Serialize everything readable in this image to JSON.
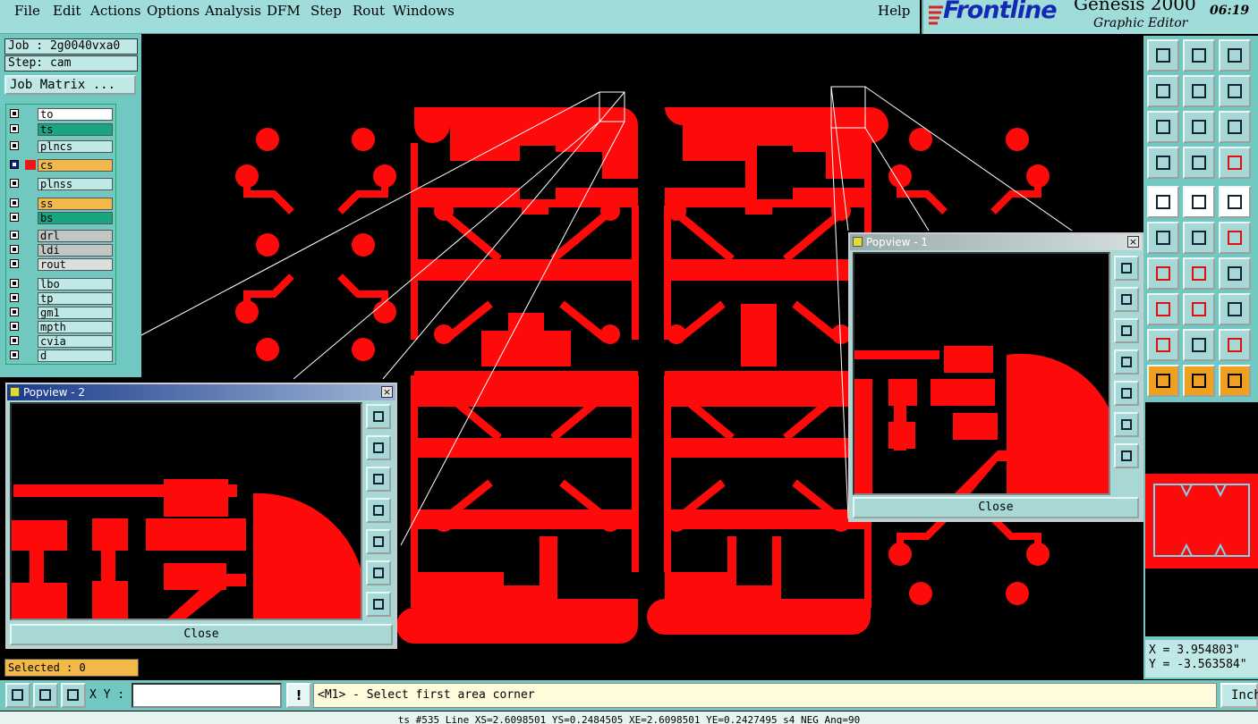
{
  "menu": [
    "File",
    "Edit",
    "Actions",
    "Options",
    "Analysis",
    "DFM",
    "Step",
    "Rout",
    "Windows"
  ],
  "help_label": "Help",
  "brand": {
    "logo": "Frontline",
    "product": "Genesis 2000",
    "subtitle": "Graphic Editor",
    "time": "06:19"
  },
  "job": {
    "job_label": "Job : 2g0040vxa0",
    "step_label": "Step: cam",
    "matrix_button": "Job Matrix ..."
  },
  "layers": [
    {
      "name": "to",
      "color": "#ffffff",
      "selected": false
    },
    {
      "name": "ts",
      "color": "#1aa582",
      "selected": false
    },
    {
      "name": "plncs",
      "color": "#bfe8e6",
      "selected": false
    },
    {
      "name": "cs",
      "color": "#f2b94a",
      "selected": true
    },
    {
      "name": "plnss",
      "color": "#bfe8e6",
      "selected": false
    },
    {
      "name": "ss",
      "color": "#f2b94a",
      "selected": false
    },
    {
      "name": "bs",
      "color": "#1aa582",
      "selected": false
    },
    {
      "name": "drl",
      "color": "#c4c4c4",
      "selected": false
    },
    {
      "name": "ldi",
      "color": "#c4c4c4",
      "selected": false
    },
    {
      "name": "rout",
      "color": "#dedede",
      "selected": false
    },
    {
      "name": "lbo",
      "color": "#bfe8e6",
      "selected": false
    },
    {
      "name": "tp",
      "color": "#bfe8e6",
      "selected": false
    },
    {
      "name": "gm1",
      "color": "#bfe8e6",
      "selected": false
    },
    {
      "name": "mpth",
      "color": "#bfe8e6",
      "selected": false
    },
    {
      "name": "cvia",
      "color": "#bfe8e6",
      "selected": false
    },
    {
      "name": "d",
      "color": "#bfe8e6",
      "selected": false
    }
  ],
  "popview1": {
    "title": "Popview - 1",
    "close_label": "Close"
  },
  "popview2": {
    "title": "Popview - 2",
    "close_label": "Close"
  },
  "coords": {
    "x": "X = 3.954803\"",
    "y": "Y = -3.563584\""
  },
  "selected_label": "Selected : 0",
  "xy_label": "X Y :",
  "xy_value": "",
  "excl_label": "!",
  "prompt": "<M1> - Select first area corner",
  "units": "Inch",
  "status": "ts #535 Line XS=2.6098501 YS=0.2484505 XE=2.6098501 YE=0.2427495 s4 NEG Ang=90",
  "colors": {
    "copper": "#ff0a0a",
    "panel": "#70c8c0",
    "menubar": "#9fdcda",
    "brand_blue": "#1428b4"
  }
}
